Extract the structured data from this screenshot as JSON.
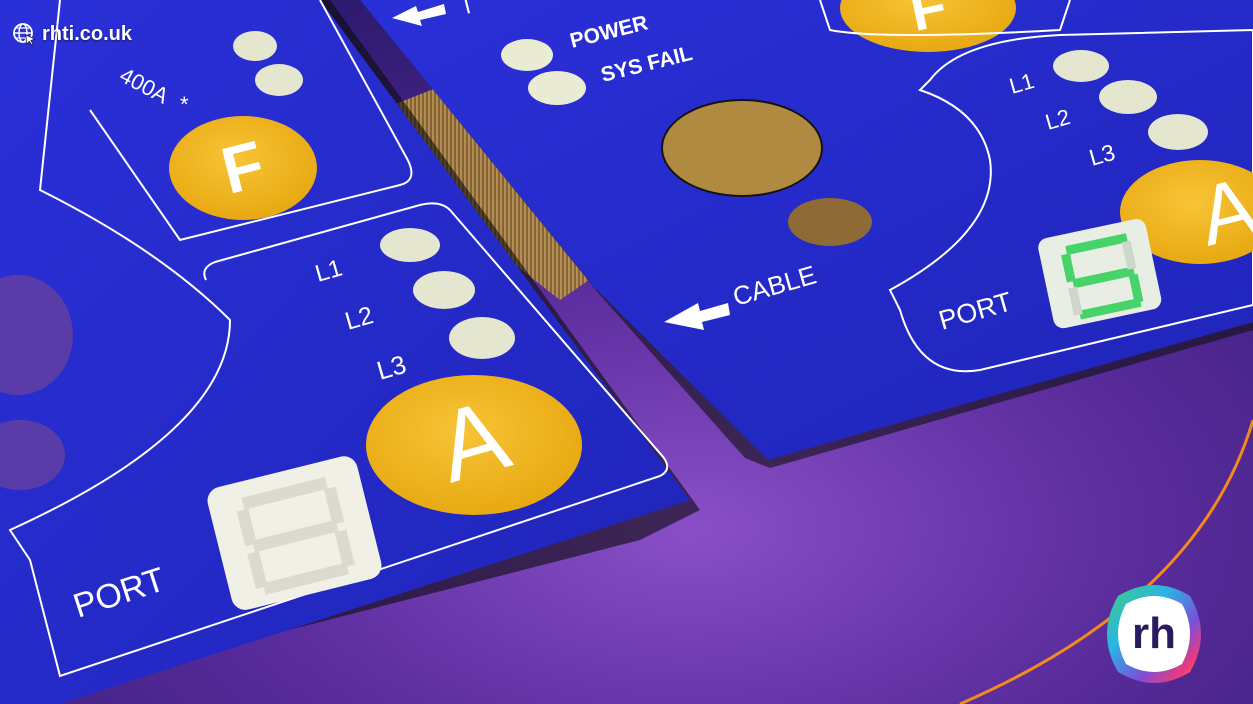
{
  "brand": {
    "url": "rhti.co.uk",
    "logo_text": "rh",
    "icons": [
      "globe-cursor-icon",
      "rh-logo"
    ]
  },
  "left_panel": {
    "top_labels": [
      "400A",
      "*"
    ],
    "f_button_label": "F",
    "led_labels": [
      "L1",
      "L2",
      "L3"
    ],
    "a_button_label": "A",
    "port_label": "PORT"
  },
  "right_panel": {
    "top_label_fragment": "I",
    "status_labels": [
      "POWER",
      "SYS FAIL"
    ],
    "cable_label": "CABLE",
    "f_button_label": "F",
    "led_labels": [
      "L1",
      "L2",
      "L3"
    ],
    "a_button_label": "A",
    "port_label": "PORT",
    "display_digit": "5"
  },
  "colors": {
    "panel_blue": "#2a2ed0",
    "button_yellow": "#f2b81f",
    "background_purple": "#5a2c9c",
    "accent_orange": "#f28a1c",
    "segment_green": "#46d36a"
  }
}
